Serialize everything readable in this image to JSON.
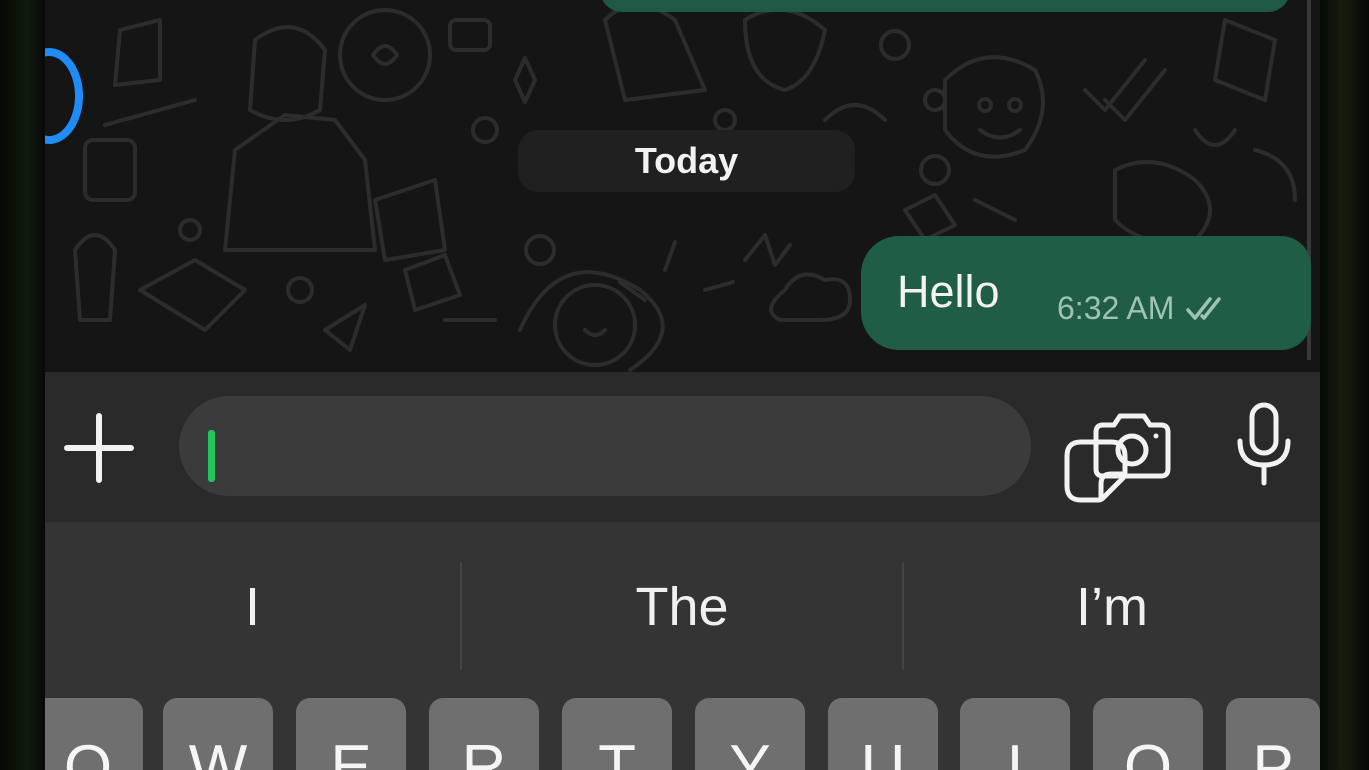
{
  "chat": {
    "date_separator": "Today",
    "messages": [
      {
        "direction": "outgoing",
        "text": "Hello",
        "time": "6:32 AM",
        "status_icon": "double-check-read-icon"
      }
    ]
  },
  "composer": {
    "attach_icon": "plus-icon",
    "input_value": "",
    "input_placeholder": "",
    "sticker_icon": "sticker-icon",
    "camera_icon": "camera-icon",
    "mic_icon": "microphone-icon",
    "caret_color": "#22c55e"
  },
  "keyboard": {
    "suggestions": [
      "I",
      "The",
      "I’m"
    ],
    "keys": [
      "Q",
      "W",
      "E",
      "R",
      "T",
      "Y",
      "U",
      "I",
      "O",
      "P"
    ]
  },
  "colors": {
    "outgoing_bubble": "#1f5d45",
    "chat_background": "#151515",
    "status_ring": "#1f8cf7"
  }
}
